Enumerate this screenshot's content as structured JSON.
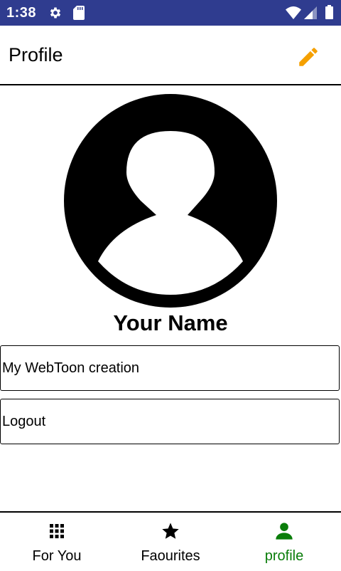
{
  "status_bar": {
    "time": "1:38",
    "icons": [
      "gear-icon",
      "sd-card-icon",
      "wifi-icon",
      "signal-icon",
      "battery-icon"
    ]
  },
  "app_bar": {
    "title": "Profile",
    "edit_icon": "pencil-icon",
    "edit_color": "#f5a000"
  },
  "profile": {
    "avatar_icon": "person-avatar-icon",
    "name": "Your Name"
  },
  "menu": {
    "creation_label": "My WebToon creation",
    "logout_label": "Logout"
  },
  "bottom_nav": {
    "items": [
      {
        "label": "For You",
        "icon": "grid-icon",
        "active": false
      },
      {
        "label": "Faourites",
        "icon": "star-icon",
        "active": false
      },
      {
        "label": "profile",
        "icon": "person-icon",
        "active": true
      }
    ],
    "active_color": "#0a7d0a"
  },
  "colors": {
    "status_bar": "#2f3c8f",
    "accent": "#f5a000"
  }
}
